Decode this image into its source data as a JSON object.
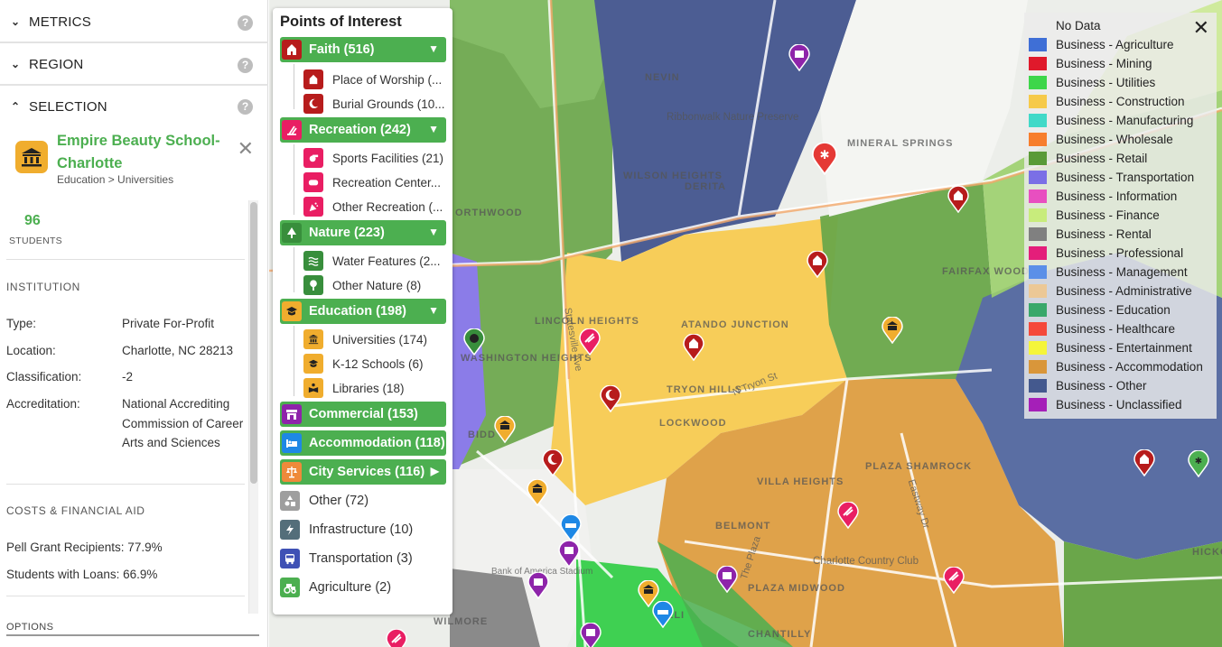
{
  "left_panel": {
    "metrics_label": "METRICS",
    "region_label": "REGION",
    "selection_label": "SELECTION",
    "help_glyph": "?",
    "selection": {
      "title": "Empire Beauty School-Charlotte",
      "subtitle": "Education > Universities",
      "close_glyph": "✕",
      "stat_value": "96",
      "stat_label": "STUDENTS"
    },
    "institution": {
      "heading": "INSTITUTION",
      "rows": [
        {
          "key": "Type:",
          "value": "Private For-Profit"
        },
        {
          "key": "Location:",
          "value": "Charlotte, NC 28213"
        },
        {
          "key": "Classification:",
          "value": "-2"
        },
        {
          "key": "Accreditation:",
          "value": "National Accrediting Commission of Career Arts and Sciences"
        }
      ]
    },
    "costs": {
      "heading": "COSTS & FINANCIAL AID",
      "pell": "Pell Grant Recipients:  77.9%",
      "loans": "Students with Loans:  66.9%"
    },
    "options_label": "OPTIONS"
  },
  "poi_panel": {
    "title": "Points of Interest",
    "categories": [
      {
        "label": "Faith (516)",
        "arrow": "▼",
        "icon": "church-icon",
        "icon_color": "#b71c1c"
      },
      {
        "label": "Recreation (242)",
        "arrow": "▼",
        "icon": "recreation-icon",
        "icon_color": "#e91e63"
      },
      {
        "label": "Nature (223)",
        "arrow": "▼",
        "icon": "tree-icon",
        "icon_color": "#388e3c"
      },
      {
        "label": "Education (198)",
        "arrow": "▼",
        "icon": "graduation-cap-icon",
        "icon_color": "#f0ad2e"
      },
      {
        "label": "Commercial (153)",
        "icon": "storefront-icon",
        "icon_color": "#8e24aa"
      },
      {
        "label": "Accommodation (118)",
        "icon": "bed-icon",
        "icon_color": "#1e88e5"
      },
      {
        "label": "City Services (116)",
        "arrow": "▶",
        "icon": "scales-icon",
        "icon_color": "#ef8a3a"
      }
    ],
    "subitems": {
      "faith": [
        "Place of Worship (...",
        "Burial Grounds (10..."
      ],
      "recreation": [
        "Sports Facilities (21)",
        "Recreation Center...",
        "Other Recreation (..."
      ],
      "nature": [
        "Water Features (2...",
        "Other Nature (8)"
      ],
      "education": [
        "Universities (174)",
        "K-12 Schools (6)",
        "Libraries (18)"
      ]
    },
    "other_items": [
      {
        "label": "Other (72)",
        "icon": "shapes-icon",
        "color": "#9e9e9e"
      },
      {
        "label": "Infrastructure (10)",
        "icon": "lightning-icon",
        "color": "#546e7a"
      },
      {
        "label": "Transportation (3)",
        "icon": "bus-icon",
        "color": "#3f51b5"
      },
      {
        "label": "Agriculture (2)",
        "icon": "tractor-icon",
        "color": "#4caf50"
      }
    ]
  },
  "legend": {
    "close_glyph": "✕",
    "entries": [
      {
        "label": "No Data",
        "color": ""
      },
      {
        "label": "Business - Agriculture",
        "color": "#3f6fd6"
      },
      {
        "label": "Business - Mining",
        "color": "#e0192b"
      },
      {
        "label": "Business - Utilities",
        "color": "#3dd64a"
      },
      {
        "label": "Business - Construction",
        "color": "#f6ca4a"
      },
      {
        "label": "Business - Manufacturing",
        "color": "#41d9c8"
      },
      {
        "label": "Business - Wholesale",
        "color": "#f77e2d"
      },
      {
        "label": "Business - Retail",
        "color": "#5a9a37"
      },
      {
        "label": "Business - Transportation",
        "color": "#7b6fe6"
      },
      {
        "label": "Business - Information",
        "color": "#e84fc0"
      },
      {
        "label": "Business - Finance",
        "color": "#c8ec7c"
      },
      {
        "label": "Business - Rental",
        "color": "#808080"
      },
      {
        "label": "Business - Professional",
        "color": "#e41e7a"
      },
      {
        "label": "Business - Management",
        "color": "#5b8fe8"
      },
      {
        "label": "Business - Administrative",
        "color": "#ecc896"
      },
      {
        "label": "Business - Education",
        "color": "#39a86a"
      },
      {
        "label": "Business - Healthcare",
        "color": "#f5493a"
      },
      {
        "label": "Business - Entertainment",
        "color": "#f5f53a"
      },
      {
        "label": "Business - Accommodation",
        "color": "#d9963a"
      },
      {
        "label": "Business - Other",
        "color": "#44598e"
      },
      {
        "label": "Business - Unclassified",
        "color": "#a51fb8"
      }
    ]
  },
  "map_labels": {
    "ribbonwalk": "Ribbonwalk Nature Preserve",
    "derita": "DERITA",
    "wilson_heights": "WILSON HEIGHTS",
    "mineral_springs": "MINERAL SPRINGS",
    "northwood": "ORTHWOOD",
    "lincoln_heights": "LINCOLN HEIGHTS",
    "washington_heights": "WASHINGTON HEIGHTS",
    "atando": "ATANDO JUNCTION",
    "tryon_hills": "TRYON HILLS",
    "lockwood": "LOCKWOOD",
    "fairfax_woods": "FAIRFAX WOODS",
    "plaza_shamrock": "PLAZA SHAMROCK",
    "villa_heights": "VILLA HEIGHTS",
    "belmont": "BELMONT",
    "charlotte_cc": "Charlotte Country Club",
    "plaza_midwood": "PLAZA MIDWOOD",
    "chantilly": "CHANTILLY",
    "wilmore": "WILMORE",
    "newell": "NEVIN",
    "statesville_ave": "Statesville Ave",
    "n_tryon": "N Tryon St",
    "bank_of_america": "Bank of America Stadium",
    "eastway": "Eastway Dr",
    "the_plaza": "The Plaza",
    "hickory": "HICKO",
    "biddleville": "BIDD",
    "elizabeth": "ELI"
  }
}
